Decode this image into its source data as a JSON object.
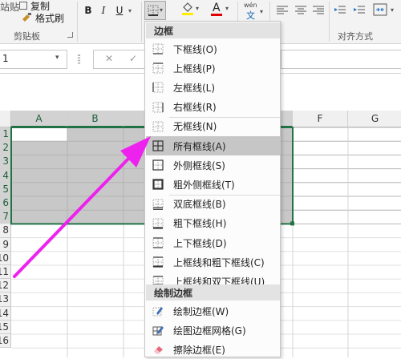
{
  "ribbon": {
    "paste_partial": "站贴",
    "copy_label": "复制",
    "format_painter_label": "格式刷",
    "clipboard_group": "剪贴板",
    "bold": "B",
    "italic": "I",
    "underline": "U",
    "font_color_letter": "A",
    "phonetic_top": "wén",
    "phonetic_bottom": "文",
    "alignment_group": "对齐方式"
  },
  "formula_bar": {
    "name_box_value": "1",
    "cancel_symbol": "✕",
    "enter_symbol": "✓"
  },
  "sheet": {
    "columns": [
      "A",
      "B",
      "F",
      "G"
    ],
    "rows": [
      "1",
      "2",
      "3",
      "4",
      "5",
      "6",
      "7",
      "8",
      "9",
      "10",
      "11",
      "12",
      "13",
      "14",
      "15",
      "16"
    ]
  },
  "menu": {
    "section_borders": "边框",
    "items": [
      "下框线(O)",
      "上框线(P)",
      "左框线(L)",
      "右框线(R)",
      "无框线(N)",
      "所有框线(A)",
      "外侧框线(S)",
      "粗外侧框线(T)",
      "双底框线(B)",
      "粗下框线(H)",
      "上下框线(D)",
      "上框线和粗下框线(C)",
      "上框线和双下框线(U)"
    ],
    "section_draw": "绘制边框",
    "draw_items": [
      "绘制边框(W)",
      "绘图边框网格(G)",
      "擦除边框(E)"
    ],
    "highlighted_item": "所有框线(A)"
  },
  "colors": {
    "selection_fill": "#c8c8c8",
    "selection_border": "#217346",
    "annotation_arrow": "#ee22ee",
    "menu_highlight": "#c6c6c6"
  }
}
